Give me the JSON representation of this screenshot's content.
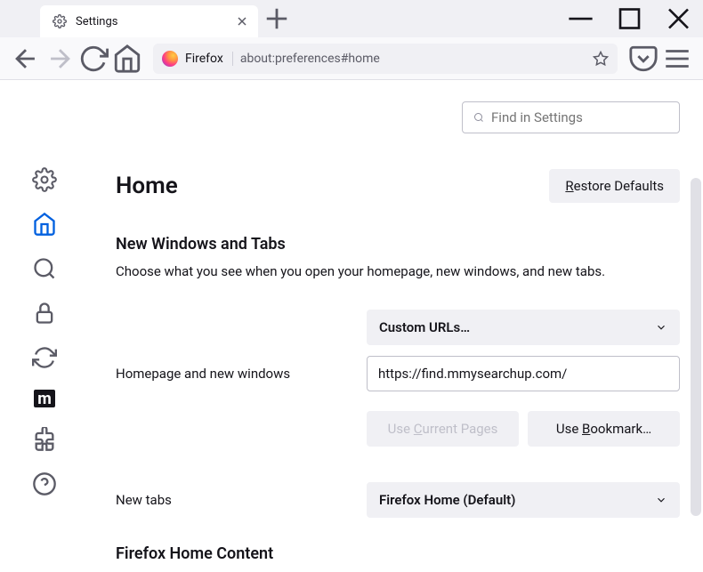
{
  "titlebar": {
    "tab_title": "Settings"
  },
  "toolbar": {
    "identity": "Firefox",
    "url": "about:preferences#home"
  },
  "search": {
    "placeholder": "Find in Settings"
  },
  "page": {
    "title": "Home",
    "restore_prefix": "R",
    "restore_rest": "estore Defaults",
    "section1_heading": "New Windows and Tabs",
    "section1_desc": "Choose what you see when you open your homepage, new windows, and new tabs.",
    "homepage_label": "Homepage and new windows",
    "homepage_dropdown": "Custom URLs…",
    "homepage_value": "https://find.mmysearchup.com/",
    "use_current_pre": "Use ",
    "use_current_u": "C",
    "use_current_post": "urrent Pages",
    "use_bookmark_pre": "Use ",
    "use_bookmark_u": "B",
    "use_bookmark_post": "ookmark…",
    "newtabs_label": "New tabs",
    "newtabs_dropdown": "Firefox Home (Default)",
    "section2_heading": "Firefox Home Content"
  },
  "sidebar": {
    "m_label": "m"
  }
}
